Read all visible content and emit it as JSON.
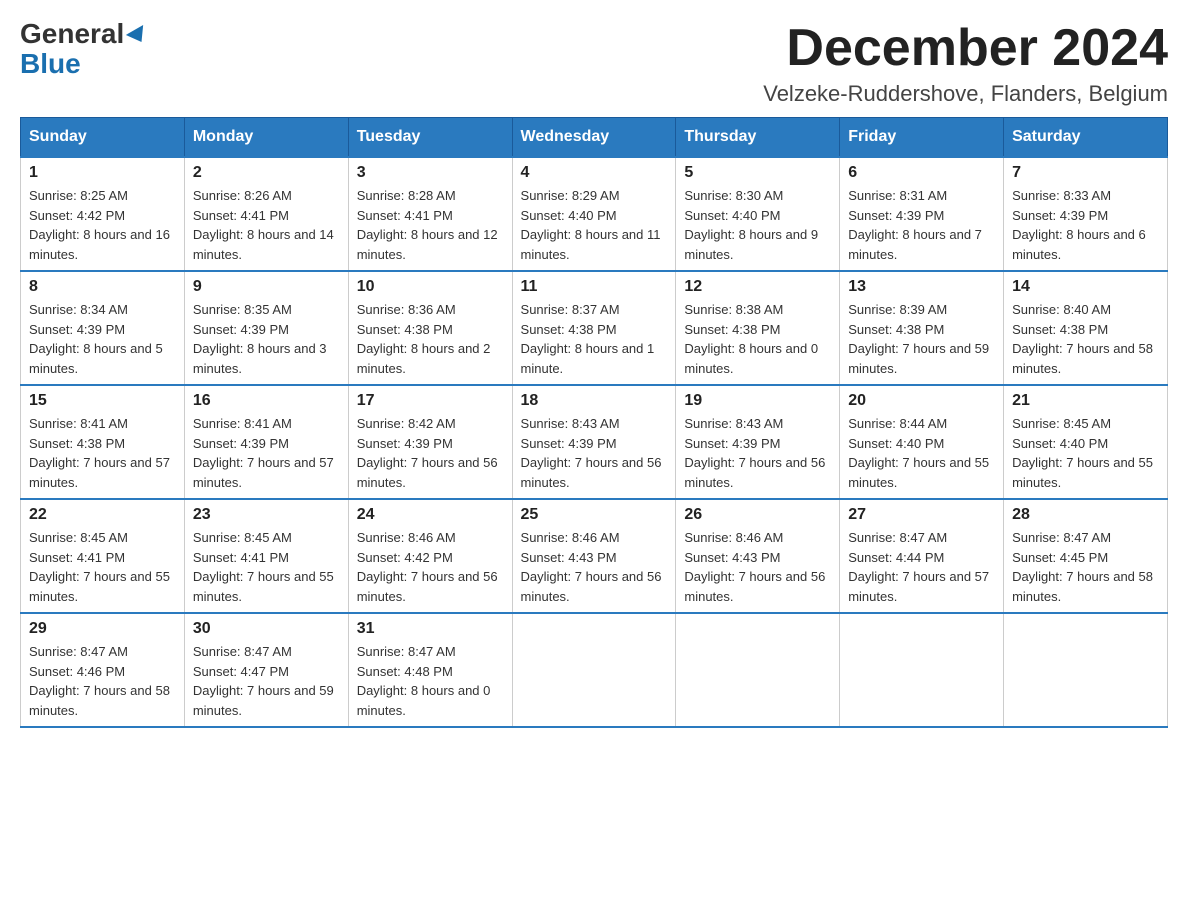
{
  "header": {
    "logo_general": "General",
    "logo_blue": "Blue",
    "month_title": "December 2024",
    "location": "Velzeke-Ruddershove, Flanders, Belgium"
  },
  "days_of_week": [
    "Sunday",
    "Monday",
    "Tuesday",
    "Wednesday",
    "Thursday",
    "Friday",
    "Saturday"
  ],
  "weeks": [
    [
      {
        "day": "1",
        "sunrise": "8:25 AM",
        "sunset": "4:42 PM",
        "daylight": "8 hours and 16 minutes."
      },
      {
        "day": "2",
        "sunrise": "8:26 AM",
        "sunset": "4:41 PM",
        "daylight": "8 hours and 14 minutes."
      },
      {
        "day": "3",
        "sunrise": "8:28 AM",
        "sunset": "4:41 PM",
        "daylight": "8 hours and 12 minutes."
      },
      {
        "day": "4",
        "sunrise": "8:29 AM",
        "sunset": "4:40 PM",
        "daylight": "8 hours and 11 minutes."
      },
      {
        "day": "5",
        "sunrise": "8:30 AM",
        "sunset": "4:40 PM",
        "daylight": "8 hours and 9 minutes."
      },
      {
        "day": "6",
        "sunrise": "8:31 AM",
        "sunset": "4:39 PM",
        "daylight": "8 hours and 7 minutes."
      },
      {
        "day": "7",
        "sunrise": "8:33 AM",
        "sunset": "4:39 PM",
        "daylight": "8 hours and 6 minutes."
      }
    ],
    [
      {
        "day": "8",
        "sunrise": "8:34 AM",
        "sunset": "4:39 PM",
        "daylight": "8 hours and 5 minutes."
      },
      {
        "day": "9",
        "sunrise": "8:35 AM",
        "sunset": "4:39 PM",
        "daylight": "8 hours and 3 minutes."
      },
      {
        "day": "10",
        "sunrise": "8:36 AM",
        "sunset": "4:38 PM",
        "daylight": "8 hours and 2 minutes."
      },
      {
        "day": "11",
        "sunrise": "8:37 AM",
        "sunset": "4:38 PM",
        "daylight": "8 hours and 1 minute."
      },
      {
        "day": "12",
        "sunrise": "8:38 AM",
        "sunset": "4:38 PM",
        "daylight": "8 hours and 0 minutes."
      },
      {
        "day": "13",
        "sunrise": "8:39 AM",
        "sunset": "4:38 PM",
        "daylight": "7 hours and 59 minutes."
      },
      {
        "day": "14",
        "sunrise": "8:40 AM",
        "sunset": "4:38 PM",
        "daylight": "7 hours and 58 minutes."
      }
    ],
    [
      {
        "day": "15",
        "sunrise": "8:41 AM",
        "sunset": "4:38 PM",
        "daylight": "7 hours and 57 minutes."
      },
      {
        "day": "16",
        "sunrise": "8:41 AM",
        "sunset": "4:39 PM",
        "daylight": "7 hours and 57 minutes."
      },
      {
        "day": "17",
        "sunrise": "8:42 AM",
        "sunset": "4:39 PM",
        "daylight": "7 hours and 56 minutes."
      },
      {
        "day": "18",
        "sunrise": "8:43 AM",
        "sunset": "4:39 PM",
        "daylight": "7 hours and 56 minutes."
      },
      {
        "day": "19",
        "sunrise": "8:43 AM",
        "sunset": "4:39 PM",
        "daylight": "7 hours and 56 minutes."
      },
      {
        "day": "20",
        "sunrise": "8:44 AM",
        "sunset": "4:40 PM",
        "daylight": "7 hours and 55 minutes."
      },
      {
        "day": "21",
        "sunrise": "8:45 AM",
        "sunset": "4:40 PM",
        "daylight": "7 hours and 55 minutes."
      }
    ],
    [
      {
        "day": "22",
        "sunrise": "8:45 AM",
        "sunset": "4:41 PM",
        "daylight": "7 hours and 55 minutes."
      },
      {
        "day": "23",
        "sunrise": "8:45 AM",
        "sunset": "4:41 PM",
        "daylight": "7 hours and 55 minutes."
      },
      {
        "day": "24",
        "sunrise": "8:46 AM",
        "sunset": "4:42 PM",
        "daylight": "7 hours and 56 minutes."
      },
      {
        "day": "25",
        "sunrise": "8:46 AM",
        "sunset": "4:43 PM",
        "daylight": "7 hours and 56 minutes."
      },
      {
        "day": "26",
        "sunrise": "8:46 AM",
        "sunset": "4:43 PM",
        "daylight": "7 hours and 56 minutes."
      },
      {
        "day": "27",
        "sunrise": "8:47 AM",
        "sunset": "4:44 PM",
        "daylight": "7 hours and 57 minutes."
      },
      {
        "day": "28",
        "sunrise": "8:47 AM",
        "sunset": "4:45 PM",
        "daylight": "7 hours and 58 minutes."
      }
    ],
    [
      {
        "day": "29",
        "sunrise": "8:47 AM",
        "sunset": "4:46 PM",
        "daylight": "7 hours and 58 minutes."
      },
      {
        "day": "30",
        "sunrise": "8:47 AM",
        "sunset": "4:47 PM",
        "daylight": "7 hours and 59 minutes."
      },
      {
        "day": "31",
        "sunrise": "8:47 AM",
        "sunset": "4:48 PM",
        "daylight": "8 hours and 0 minutes."
      },
      null,
      null,
      null,
      null
    ]
  ],
  "labels": {
    "sunrise_prefix": "Sunrise: ",
    "sunset_prefix": "Sunset: ",
    "daylight_prefix": "Daylight: "
  }
}
